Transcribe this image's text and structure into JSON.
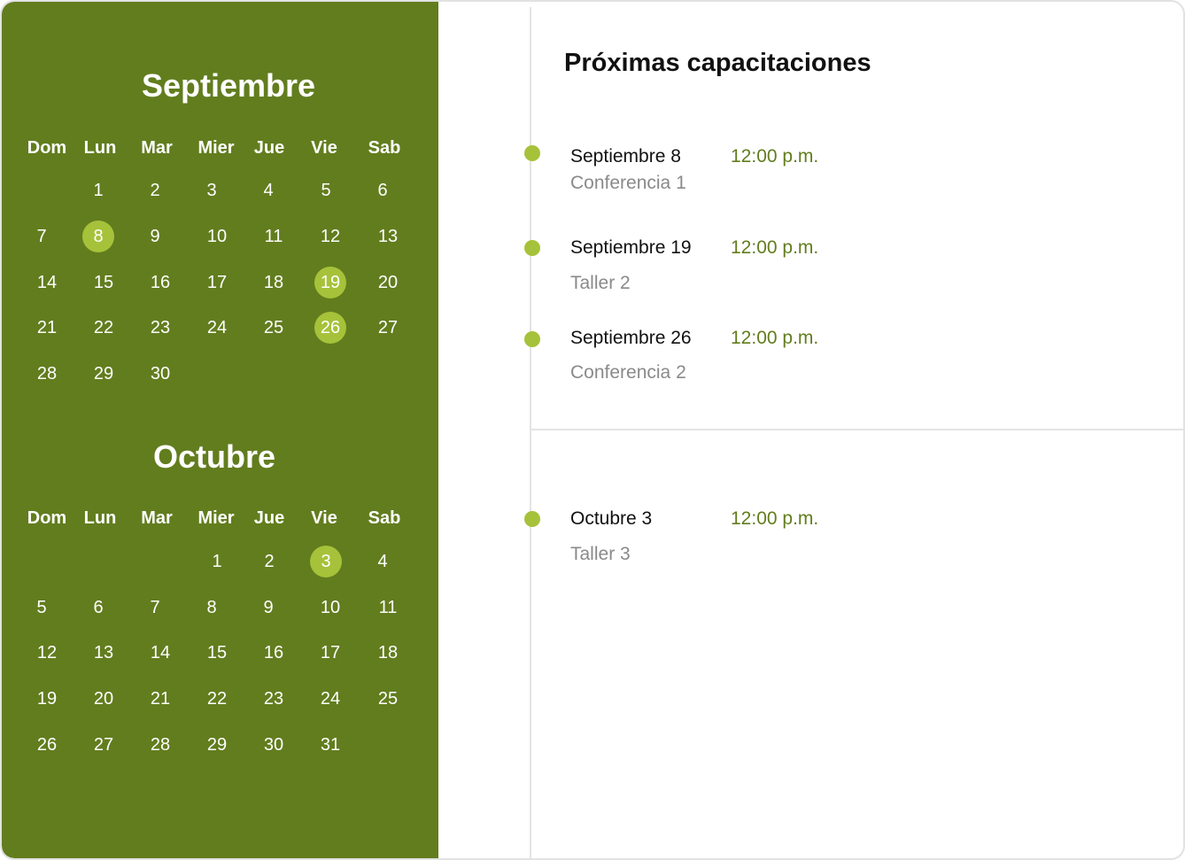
{
  "weekdays": [
    "Dom",
    "Lun",
    "Mar",
    "Mier",
    "Jue",
    "Vie",
    "Sab"
  ],
  "calendar": {
    "september": {
      "title": "Septiembre",
      "days": [
        "1",
        "2",
        "3",
        "4",
        "5",
        "6",
        "7",
        "8",
        "9",
        "10",
        "11",
        "12",
        "13",
        "14",
        "15",
        "16",
        "17",
        "18",
        "19",
        "20",
        "21",
        "22",
        "23",
        "24",
        "25",
        "26",
        "27",
        "28",
        "29",
        "30"
      ],
      "highlighted": [
        "8",
        "19",
        "26"
      ]
    },
    "october": {
      "title": "Octubre",
      "days": [
        "1",
        "2",
        "3",
        "4",
        "5",
        "6",
        "7",
        "8",
        "9",
        "10",
        "11",
        "12",
        "13",
        "14",
        "15",
        "16",
        "17",
        "18",
        "19",
        "20",
        "21",
        "22",
        "23",
        "24",
        "25",
        "26",
        "27",
        "28",
        "29",
        "30",
        "31"
      ],
      "highlighted": [
        "3"
      ]
    }
  },
  "upcoming": {
    "title": "Próximas capacitaciones",
    "events": [
      {
        "date": "Septiembre 8",
        "time": "12:00 p.m.",
        "name": "Conferencia 1"
      },
      {
        "date": "Septiembre 19",
        "time": "12:00 p.m.",
        "name": "Taller 2"
      },
      {
        "date": "Septiembre 26",
        "time": "12:00 p.m.",
        "name": "Conferencia 2"
      },
      {
        "date": "Octubre 3",
        "time": "12:00 p.m.",
        "name": "Taller 3"
      }
    ]
  },
  "colors": {
    "panel": "#627d1e",
    "highlight": "#a6c23a",
    "time_text": "#627d1e",
    "muted_text": "#8a8a8a"
  }
}
